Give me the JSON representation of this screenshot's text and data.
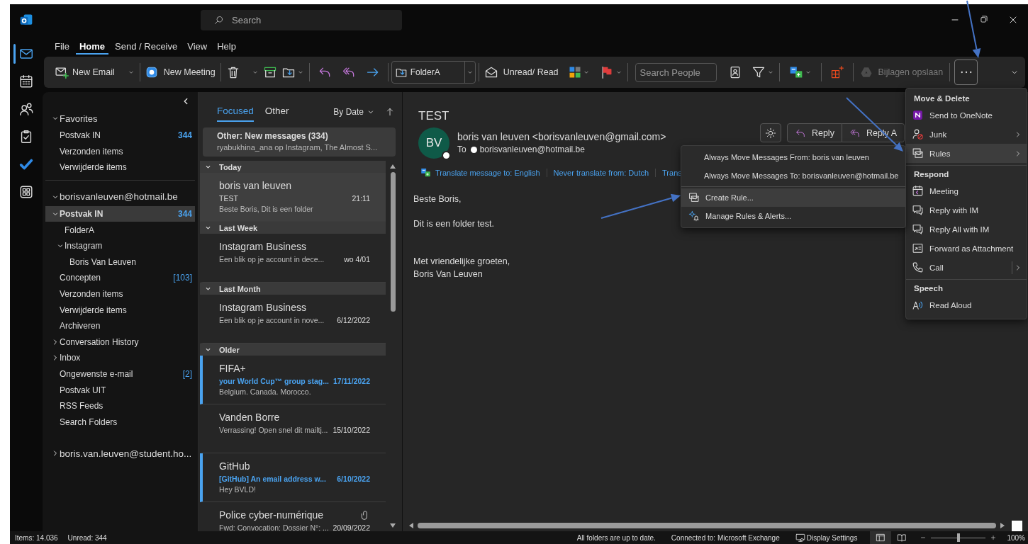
{
  "title_bar": {
    "search_placeholder": "Search"
  },
  "nav_rail": [
    {
      "kind": "mail",
      "selected": true
    },
    {
      "kind": "calendar",
      "selected": false
    },
    {
      "kind": "people",
      "selected": false
    },
    {
      "kind": "tasks",
      "selected": false
    },
    {
      "kind": "todo",
      "selected": false
    },
    {
      "kind": "apps",
      "selected": false
    }
  ],
  "menu_tabs": [
    {
      "label": "File",
      "selected": false
    },
    {
      "label": "Home",
      "selected": true
    },
    {
      "label": "Send / Receive",
      "selected": false
    },
    {
      "label": "View",
      "selected": false
    },
    {
      "label": "Help",
      "selected": false
    }
  ],
  "ribbon": [
    {
      "kind": "new-email",
      "label": "New Email"
    },
    {
      "kind": "separator"
    },
    {
      "kind": "new-meeting",
      "label": "New Meeting"
    },
    {
      "kind": "separator"
    },
    {
      "kind": "delete"
    },
    {
      "kind": "archive"
    },
    {
      "kind": "move"
    },
    {
      "kind": "separator"
    },
    {
      "kind": "reply"
    },
    {
      "kind": "reply-all"
    },
    {
      "kind": "forward"
    },
    {
      "kind": "separator"
    },
    {
      "kind": "folder-select",
      "value": "FolderA"
    },
    {
      "kind": "separator"
    },
    {
      "kind": "unread",
      "label": "Unread/ Read"
    },
    {
      "kind": "categorize"
    },
    {
      "kind": "flag"
    },
    {
      "kind": "separator"
    },
    {
      "kind": "search-people",
      "placeholder": "Search People"
    },
    {
      "kind": "address-book"
    },
    {
      "kind": "filter"
    },
    {
      "kind": "separator"
    },
    {
      "kind": "translate"
    },
    {
      "kind": "separator"
    },
    {
      "kind": "addin"
    },
    {
      "kind": "separator"
    },
    {
      "kind": "save-attachments",
      "label": "Bijlagen opslaan",
      "disabled": true
    },
    {
      "kind": "separator"
    },
    {
      "kind": "more"
    }
  ],
  "folders": [
    {
      "kind": "favorites",
      "label": "Favorites",
      "expanded": true,
      "selected": false,
      "children": [
        {
          "label": "Postvak IN",
          "count": "344",
          "selected": false
        },
        {
          "label": "Verzonden items",
          "selected": false
        },
        {
          "label": "Verwijderde items",
          "selected": false
        }
      ]
    },
    {
      "kind": "account",
      "label": "borisvanleuven@hotmail.be",
      "expanded": true,
      "selected": false,
      "children": [
        {
          "label": "Postvak IN",
          "count": "344",
          "expanded": true,
          "selected": true,
          "children": [
            {
              "label": "FolderA",
              "selected": false
            },
            {
              "label": "Instagram",
              "expanded": true,
              "selected": false,
              "children": [
                {
                  "label": "Boris Van Leuven",
                  "selected": false
                }
              ]
            }
          ]
        },
        {
          "label": "Concepten",
          "count": "[103]",
          "selected": false
        },
        {
          "label": "Verzonden items",
          "selected": false
        },
        {
          "label": "Verwijderde items",
          "selected": false
        },
        {
          "label": "Archiveren",
          "selected": false
        },
        {
          "label": "Conversation History",
          "expanded": false,
          "selected": false
        },
        {
          "label": "Inbox",
          "expanded": false,
          "selected": false
        },
        {
          "label": "Ongewenste e-mail",
          "count": "[2]",
          "selected": false
        },
        {
          "label": "Postvak UIT",
          "selected": false
        },
        {
          "label": "RSS Feeds",
          "selected": false
        },
        {
          "label": "Search Folders",
          "selected": false
        }
      ]
    },
    {
      "kind": "account",
      "label": "boris.van.leuven@student.ho...",
      "expanded": false,
      "selected": false
    }
  ],
  "message_list": {
    "tabs": [
      {
        "label": "Focused",
        "selected": true
      },
      {
        "label": "Other",
        "selected": false
      }
    ],
    "sort": "By Date",
    "banner": {
      "title": "Other: New messages (334)",
      "preview": "ryabukhina_ana op Instagram, The Almost S..."
    },
    "groups": [
      {
        "label": "Today",
        "expanded": true,
        "messages": [
          {
            "sender": "boris van leuven",
            "subject": "TEST",
            "preview": "Beste Boris,  Dit is een folder",
            "date": "21:11",
            "unread": false,
            "selected": true,
            "attachment": false
          }
        ]
      },
      {
        "label": "Last Week",
        "expanded": true,
        "messages": [
          {
            "sender": "Instagram Business",
            "preview": "Een blik op je account in dece...",
            "date": "wo 4/01",
            "unread": false,
            "selected": false,
            "attachment": false
          }
        ]
      },
      {
        "label": "Last Month",
        "expanded": true,
        "messages": [
          {
            "sender": "Instagram Business",
            "preview": "Een blik op je account in nove...",
            "date": "6/12/2022",
            "unread": false,
            "selected": false,
            "attachment": false
          }
        ]
      },
      {
        "label": "Older",
        "expanded": true,
        "messages": [
          {
            "sender": "FIFA+",
            "subject": "your World Cup™ group stag...",
            "preview": "Belgium. Canada. Morocco.",
            "date": "17/11/2022",
            "unread": true,
            "selected": false,
            "attachment": false
          },
          {
            "sender": "Vanden Borre",
            "preview": "Verrassing! Open snel dit mailtj...",
            "date": "15/10/2022",
            "unread": false,
            "selected": false,
            "attachment": false
          },
          {
            "sender": "GitHub",
            "subject": "[GitHub] An email address w...",
            "preview": "Hey BVLD!",
            "date": "6/10/2022",
            "unread": true,
            "selected": false,
            "attachment": false
          },
          {
            "sender": "Police cyber-numérique",
            "preview": "Fwd: Convocation: Dossier N°: ...",
            "date": "20/09/2022",
            "unread": false,
            "selected": false,
            "attachment": true
          }
        ]
      }
    ]
  },
  "reading": {
    "subject": "TEST",
    "avatar_initials": "BV",
    "from": "boris van leuven <borisvanleuven@gmail.com>",
    "to_label": "To",
    "to": "borisvanleuven@hotmail.be",
    "translate_links": [
      "Translate message to: English",
      "Never translate from: Dutch",
      "Trans"
    ],
    "actions": [
      {
        "kind": "theme"
      },
      {
        "kind": "reply",
        "label": "Reply"
      },
      {
        "kind": "reply-all",
        "label": "Reply A"
      }
    ],
    "body": [
      [
        "Beste Boris,"
      ],
      [
        "Dit is een folder test."
      ],
      [
        "Met vriendelijke groeten,",
        "Boris Van Leuven"
      ]
    ]
  },
  "more_menu": [
    {
      "heading": "Move & Delete",
      "items": [
        {
          "kind": "onenote",
          "label": "Send to OneNote",
          "selected": false
        },
        {
          "kind": "junk",
          "label": "Junk",
          "submenu": true,
          "selected": false
        },
        {
          "kind": "rules",
          "label": "Rules",
          "submenu": true,
          "selected": true
        }
      ]
    },
    {
      "heading": "Respond",
      "items": [
        {
          "kind": "meeting",
          "label": "Meeting",
          "selected": false
        },
        {
          "kind": "chat",
          "label": "Reply with IM",
          "selected": false
        },
        {
          "kind": "chat",
          "label": "Reply All with IM",
          "selected": false
        },
        {
          "kind": "forward-attachment",
          "label": "Forward as Attachment",
          "selected": false
        },
        {
          "kind": "call",
          "label": "Call",
          "submenu": true,
          "split_button": true,
          "selected": false
        }
      ]
    },
    {
      "heading": "Speech",
      "items": [
        {
          "kind": "read-aloud",
          "label": "Read Aloud",
          "selected": false
        }
      ]
    }
  ],
  "rules_menu": [
    {
      "kind": "text",
      "label": "Always Move Messages From: boris van leuven",
      "selected": false
    },
    {
      "kind": "text",
      "label": "Always Move Messages To: borisvanleuven@hotmail.be",
      "selected": false
    },
    {
      "kind": "separator"
    },
    {
      "kind": "create-rule",
      "label": "Create Rule...",
      "selected": true
    },
    {
      "kind": "manage-rules",
      "label": "Manage Rules & Alerts...",
      "selected": false
    }
  ],
  "status_bar": {
    "left": [
      "Items: 14.036",
      "Unread: 344"
    ],
    "right": [
      "All folders are up to date.",
      "Connected to: Microsoft Exchange"
    ],
    "display_settings": "Display Settings",
    "views": [
      {
        "kind": "normal",
        "selected": true
      },
      {
        "kind": "reading",
        "selected": false
      }
    ],
    "zoom": {
      "level": 0.5,
      "reading": "100%"
    }
  }
}
